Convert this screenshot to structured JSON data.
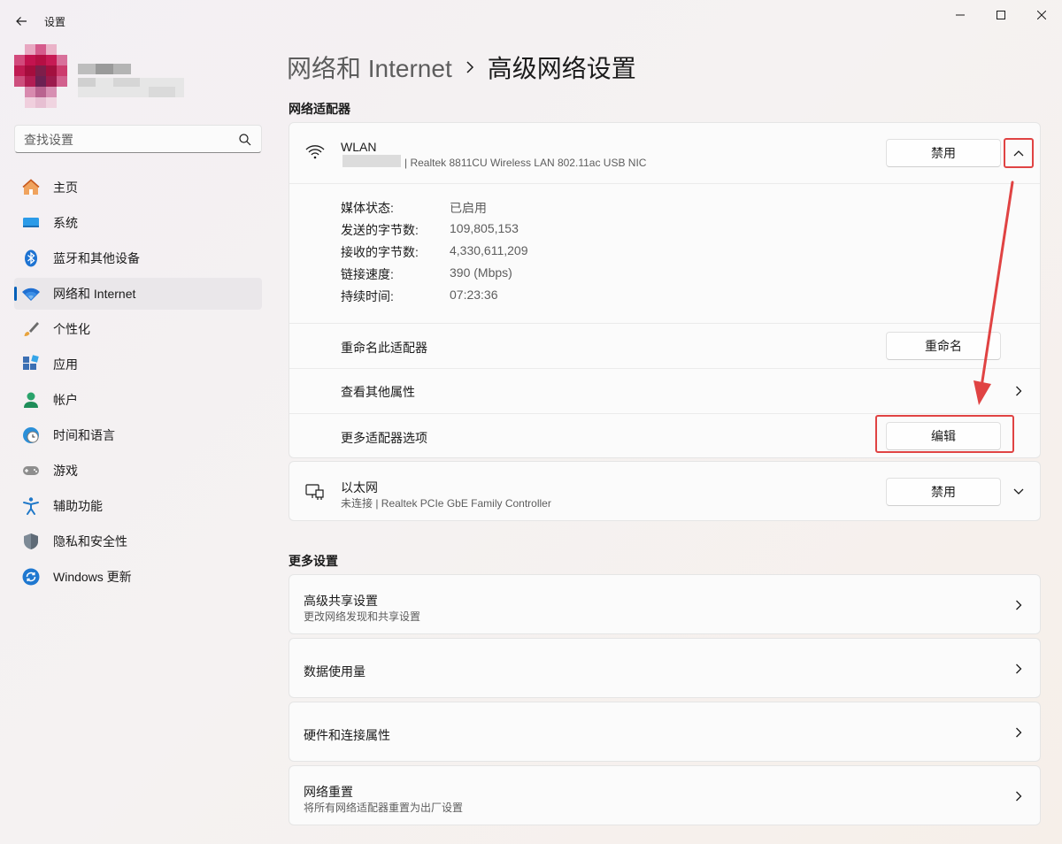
{
  "window": {
    "title": "设置"
  },
  "search": {
    "placeholder": "查找设置"
  },
  "nav": [
    {
      "label": "主页",
      "icon": "home-icon"
    },
    {
      "label": "系统",
      "icon": "system-icon"
    },
    {
      "label": "蓝牙和其他设备",
      "icon": "bluetooth-icon"
    },
    {
      "label": "网络和 Internet",
      "icon": "wifi-icon",
      "active": true
    },
    {
      "label": "个性化",
      "icon": "brush-icon"
    },
    {
      "label": "应用",
      "icon": "apps-icon"
    },
    {
      "label": "帐户",
      "icon": "account-icon"
    },
    {
      "label": "时间和语言",
      "icon": "clock-globe-icon"
    },
    {
      "label": "游戏",
      "icon": "gamepad-icon"
    },
    {
      "label": "辅助功能",
      "icon": "accessibility-icon"
    },
    {
      "label": "隐私和安全性",
      "icon": "shield-icon"
    },
    {
      "label": "Windows 更新",
      "icon": "update-icon"
    }
  ],
  "breadcrumb": {
    "parent": "网络和 Internet",
    "current": "高级网络设置"
  },
  "adapters": {
    "section_title": "网络适配器",
    "wlan": {
      "name": "WLAN",
      "description": "| Realtek 8811CU Wireless LAN 802.11ac USB NIC",
      "disable_label": "禁用",
      "properties": [
        {
          "label": "媒体状态:",
          "value": "已启用"
        },
        {
          "label": "发送的字节数:",
          "value": "109,805,153"
        },
        {
          "label": "接收的字节数:",
          "value": "4,330,611,209"
        },
        {
          "label": "链接速度:",
          "value": "390 (Mbps)"
        },
        {
          "label": "持续时间:",
          "value": "07:23:36"
        }
      ],
      "rename_label": "重命名此适配器",
      "rename_button": "重命名",
      "other_props_label": "查看其他属性",
      "more_options_label": "更多适配器选项",
      "edit_button": "编辑"
    },
    "ethernet": {
      "name": "以太网",
      "description": "未连接 | Realtek PCIe GbE Family Controller",
      "disable_label": "禁用"
    }
  },
  "more_settings": {
    "section_title": "更多设置",
    "items": [
      {
        "title": "高级共享设置",
        "subtitle": "更改网络发现和共享设置"
      },
      {
        "title": "数据使用量",
        "subtitle": ""
      },
      {
        "title": "硬件和连接属性",
        "subtitle": ""
      },
      {
        "title": "网络重置",
        "subtitle": "将所有网络适配器重置为出厂设置"
      }
    ]
  },
  "colors": {
    "accent": "#005fb8",
    "highlight": "#e04343"
  }
}
